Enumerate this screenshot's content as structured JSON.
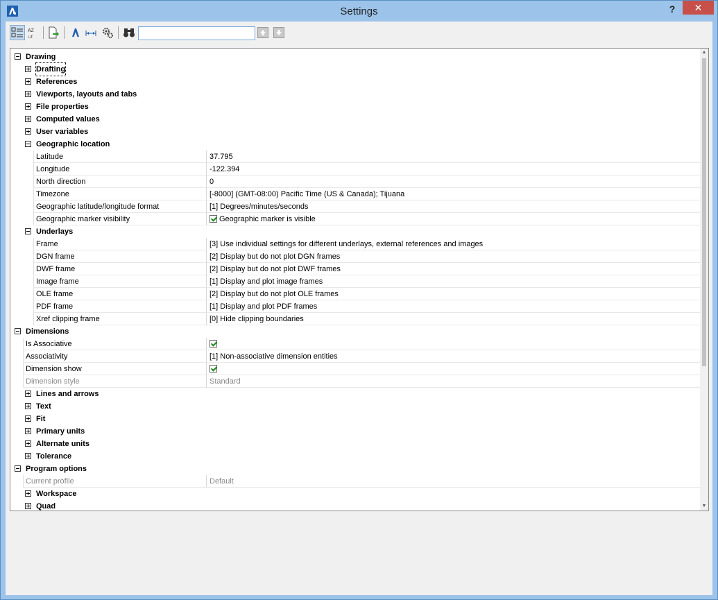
{
  "window": {
    "title": "Settings",
    "help": "?",
    "close": "✕"
  },
  "toolbar": {
    "search_value": "",
    "buttons": [
      "categorized-icon",
      "alphabetical-icon",
      "export-icon",
      "pin-icon",
      "dimension-icon",
      "gear-icon",
      "binoculars-icon"
    ]
  },
  "tree": {
    "drawing": "Drawing",
    "drafting": "Drafting",
    "references": "References",
    "viewports": "Viewports, layouts and tabs",
    "file_properties": "File properties",
    "computed_values": "Computed values",
    "user_variables": "User variables",
    "geo_location": "Geographic location",
    "geo": {
      "latitude": {
        "name": "Latitude",
        "value": "37.795"
      },
      "longitude": {
        "name": "Longitude",
        "value": "-122.394"
      },
      "north_direction": {
        "name": "North direction",
        "value": "0"
      },
      "timezone": {
        "name": "Timezone",
        "value": "[-8000] (GMT-08:00) Pacific Time (US & Canada); Tijuana"
      },
      "format": {
        "name": "Geographic latitude/longitude format",
        "value": "[1] Degrees/minutes/seconds"
      },
      "marker": {
        "name": "Geographic marker visibility",
        "value": "Geographic marker is visible"
      }
    },
    "underlays": "Underlays",
    "und": {
      "frame": {
        "name": "Frame",
        "value": "[3] Use individual settings for different underlays, external references and images"
      },
      "dgn": {
        "name": "DGN frame",
        "value": "[2] Display but do not plot DGN frames"
      },
      "dwf": {
        "name": "DWF frame",
        "value": "[2] Display but do not plot DWF frames"
      },
      "image": {
        "name": "Image frame",
        "value": "[1] Display and plot image frames"
      },
      "ole": {
        "name": "OLE frame",
        "value": "[2] Display but do not plot OLE frames"
      },
      "pdf": {
        "name": "PDF frame",
        "value": "[1] Display and plot PDF frames"
      },
      "xref": {
        "name": "Xref clipping frame",
        "value": "[0] Hide clipping boundaries"
      }
    },
    "dimensions": "Dimensions",
    "dim": {
      "is_associative": {
        "name": "Is Associative"
      },
      "associativity": {
        "name": "Associativity",
        "value": "[1] Non-associative dimension entities"
      },
      "show": {
        "name": "Dimension show"
      },
      "style": {
        "name": "Dimension style",
        "value": "Standard"
      }
    },
    "lines_arrows": "Lines and arrows",
    "text": "Text",
    "fit": "Fit",
    "primary_units": "Primary units",
    "alternate_units": "Alternate units",
    "tolerance": "Tolerance",
    "program_options": "Program options",
    "current_profile": {
      "name": "Current profile",
      "value": "Default"
    },
    "workspace": "Workspace",
    "quad": "Quad"
  }
}
